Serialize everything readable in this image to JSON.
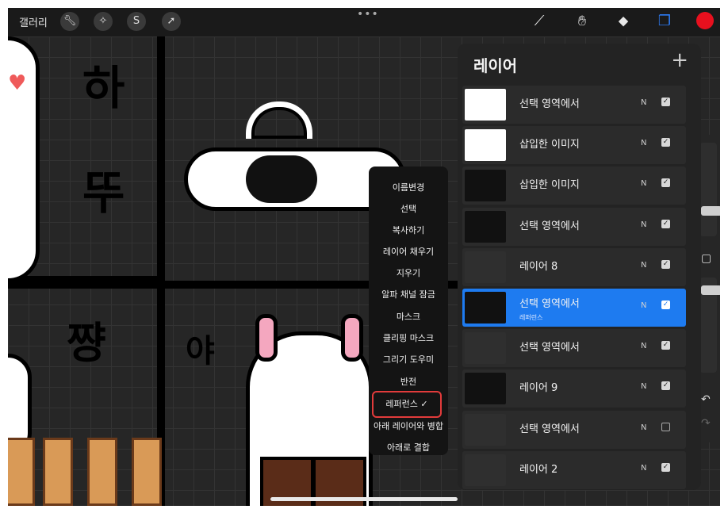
{
  "topbar": {
    "gallery_label": "갤러리",
    "left_tools": [
      "wrench-icon",
      "magic-wand-icon",
      "selection-icon",
      "transform-arrow-icon"
    ],
    "right_tools": [
      "brush-icon",
      "smudge-icon",
      "eraser-icon",
      "layers-icon"
    ],
    "more_dots": "•••",
    "current_color": "#e8101e"
  },
  "layers_panel": {
    "title": "레이어",
    "add_icon": "+",
    "layers": [
      {
        "name": "선택 영역에서",
        "blend": "N",
        "visible": true
      },
      {
        "name": "삽입한 이미지",
        "blend": "N",
        "visible": true
      },
      {
        "name": "삽입한 이미지",
        "blend": "N",
        "visible": true
      },
      {
        "name": "선택 영역에서",
        "blend": "N",
        "visible": true
      },
      {
        "name": "레이어 8",
        "blend": "N",
        "visible": true
      },
      {
        "name": "선택 영역에서",
        "sub": "레퍼런스",
        "blend": "N",
        "visible": true,
        "selected": true
      },
      {
        "name": "선택 영역에서",
        "blend": "N",
        "visible": true
      },
      {
        "name": "레이어 9",
        "blend": "N",
        "visible": true
      },
      {
        "name": "선택 영역에서",
        "blend": "N",
        "visible": false
      },
      {
        "name": "레이어 2",
        "blend": "N",
        "visible": true
      }
    ]
  },
  "context_menu": {
    "items": [
      "이름변경",
      "선택",
      "복사하기",
      "레이어 채우기",
      "지우기",
      "알파 채널 잠금",
      "마스크",
      "클리핑 마스크",
      "그리기 도우미",
      "반전",
      "레퍼런스 ✓",
      "아래 레이어와 병합",
      "아래로 결합"
    ],
    "highlighted": "레퍼런스 ✓"
  },
  "sidebar": {
    "undo_icon": "↶",
    "redo_icon": "↷",
    "square_icon": "▢"
  },
  "canvas_text": {
    "top_left_1": "하",
    "top_left_2": "뚜",
    "bottom_left": "쨩",
    "bottom_mid": "야"
  }
}
